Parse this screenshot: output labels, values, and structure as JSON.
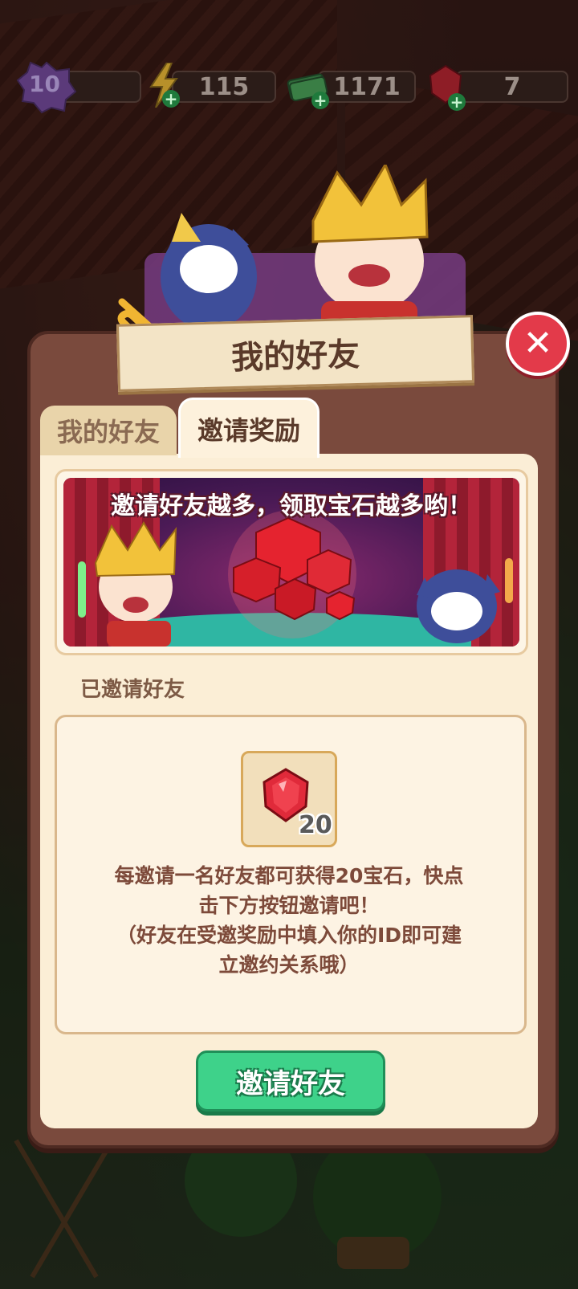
{
  "hud": {
    "level": "10",
    "energy": "115",
    "cash": "1171",
    "gems": "7",
    "plus_symbol": "+"
  },
  "dialog": {
    "title": "我的好友",
    "close_symbol": "✕",
    "tabs": [
      {
        "label": "我的好友",
        "active": false
      },
      {
        "label": "邀请奖励",
        "active": true
      }
    ],
    "banner_text": "邀请好友越多，领取宝石越多哟！",
    "invited_label": "已邀请好友",
    "reward": {
      "icon": "ruby-gem-icon",
      "quantity": "20"
    },
    "description_lines": [
      "每邀请一名好友都可获得20宝石，快点",
      "击下方按钮邀请吧！",
      "（好友在受邀奖励中填入你的ID即可建",
      "立邀约关系哦）"
    ],
    "invite_button": "邀请好友"
  },
  "colors": {
    "dialog_frame": "#7a4a3d",
    "panel": "#fbeed6",
    "gem_red": "#e02a3a",
    "button_green": "#3ed28a",
    "close_red": "#e33a4a"
  }
}
